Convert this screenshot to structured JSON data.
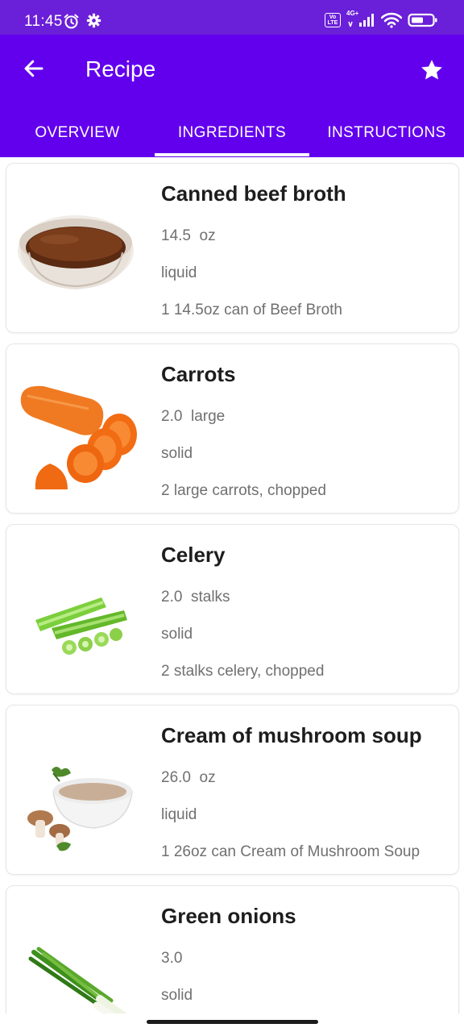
{
  "status_bar": {
    "time": "11:45",
    "left_icons": [
      "alarm-icon",
      "settings-icon"
    ],
    "right_icons": [
      "volte-icon",
      "signal-4g-icon",
      "wifi-icon",
      "battery-icon"
    ],
    "network_label": "4G+",
    "volte_label": "Vo LTE"
  },
  "app_bar": {
    "title": "Recipe",
    "back_icon": "arrow-left-icon",
    "favorite_icon": "star-icon",
    "color": "#6200ee"
  },
  "tabs": [
    {
      "label": "OVERVIEW",
      "active": false
    },
    {
      "label": "INGREDIENTS",
      "active": true
    },
    {
      "label": "INSTRUCTIONS",
      "active": false
    }
  ],
  "ingredients": [
    {
      "name": "Canned beef broth",
      "amount": "14.5",
      "unit": "oz",
      "state": "liquid",
      "description": "1 14.5oz can of Beef Broth",
      "image": "beef-broth-bowl"
    },
    {
      "name": "Carrots",
      "amount": "2.0",
      "unit": "large",
      "state": "solid",
      "description": "2 large carrots, chopped",
      "image": "carrots"
    },
    {
      "name": "Celery",
      "amount": "2.0",
      "unit": "stalks",
      "state": "solid",
      "description": "2 stalks celery, chopped",
      "image": "celery"
    },
    {
      "name": "Cream of mushroom soup",
      "amount": "26.0",
      "unit": "oz",
      "state": "liquid",
      "description": "1 26oz can Cream of Mushroom Soup",
      "image": "mushroom-soup-bowl"
    },
    {
      "name": "Green onions",
      "amount": "3.0",
      "unit": "",
      "state": "solid",
      "description": "",
      "image": "green-onions"
    }
  ]
}
